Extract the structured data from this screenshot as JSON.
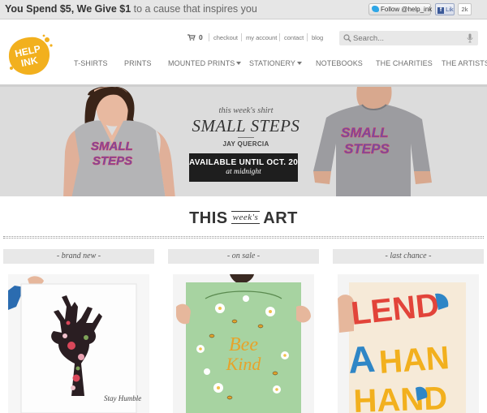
{
  "promo": {
    "bold": "You Spend $5, We Give $1",
    "rest": " to a cause that inspires you"
  },
  "social": {
    "twitter_label": "Follow @help_ink",
    "facebook_label": "Like",
    "facebook_count": "2k"
  },
  "header": {
    "logo_text_1": "HELP",
    "logo_text_2": "INK",
    "cart_count": "0",
    "links": [
      "checkout",
      "my account",
      "contact",
      "blog"
    ],
    "search_placeholder": "Search..."
  },
  "nav": [
    "T-SHIRTS",
    "PRINTS",
    "MOUNTED PRINTS",
    "STATIONERY",
    "NOTEBOOKS",
    "THE CHARITIES",
    "THE ARTISTS"
  ],
  "hero": {
    "subtitle": "this week's shirt",
    "title": "SMALL STEPS",
    "artist": "JAY QUERCIA",
    "cta_line1": "AVAILABLE UNTIL OCT. 20",
    "cta_line2": "at midnight",
    "shirt_print_1": "SMALL",
    "shirt_print_2": "STEPS"
  },
  "section": {
    "title_left": "THIS",
    "title_mid": "week's",
    "title_right": "ART"
  },
  "products": [
    {
      "tab": "- brand new -",
      "poster_text": "Stay Humble"
    },
    {
      "tab": "- on sale -",
      "poster_text_1": "Bee",
      "poster_text_2": "Kind"
    },
    {
      "tab": "- last chance -",
      "poster_text": "LEND A HAND"
    }
  ],
  "colors": {
    "logo_yellow": "#f2b01e",
    "cta_bg": "#1e1e1e",
    "hero_bg": "#dcdcdc",
    "poster_green": "#a7d3a1",
    "poster_red": "#e2443a",
    "poster_blue": "#2f86c6"
  }
}
